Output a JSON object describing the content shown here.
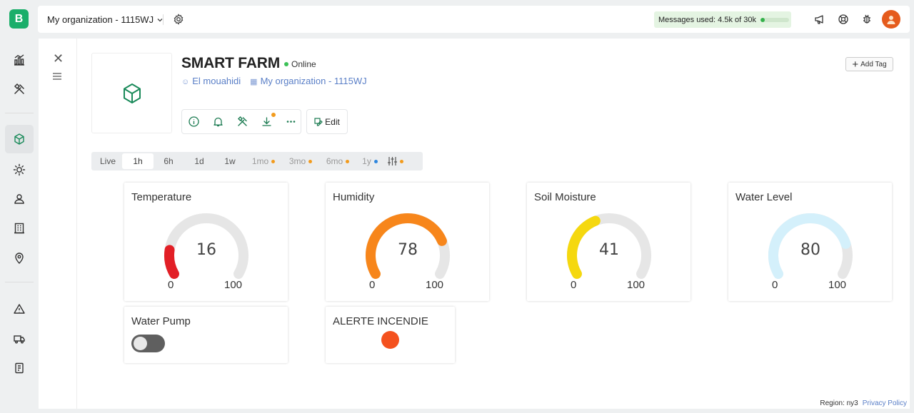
{
  "app": {
    "logo_letter": "B",
    "org_selector": "My organization - 1115WJ",
    "messages_label": "Messages used: ",
    "messages_value": "4.5k of 30k",
    "messages_fraction": 0.15
  },
  "device": {
    "name": "SMART FARM",
    "status": "Online",
    "owner": "El mouahidi",
    "organization": "My organization - 1115WJ",
    "edit_label": "Edit",
    "add_tag_label": "Add Tag"
  },
  "time_ranges": [
    {
      "label": "Live",
      "state": "normal"
    },
    {
      "label": "1h",
      "state": "selected"
    },
    {
      "label": "6h",
      "state": "normal"
    },
    {
      "label": "1d",
      "state": "normal"
    },
    {
      "label": "1w",
      "state": "normal"
    },
    {
      "label": "1mo",
      "state": "dim",
      "dot": "#f29b1d"
    },
    {
      "label": "3mo",
      "state": "dim",
      "dot": "#f29b1d"
    },
    {
      "label": "6mo",
      "state": "dim",
      "dot": "#f29b1d"
    },
    {
      "label": "1y",
      "state": "dim",
      "dot": "#2e86de"
    }
  ],
  "widgets": {
    "temperature": {
      "title": "Temperature",
      "value": "16",
      "min": "0",
      "max": "100",
      "fraction": 0.16,
      "color": "#e21f26"
    },
    "humidity": {
      "title": "Humidity",
      "value": "78",
      "min": "0",
      "max": "100",
      "fraction": 0.78,
      "color": "#f7861b"
    },
    "soil": {
      "title": "Soil Moisture",
      "value": "41",
      "min": "0",
      "max": "100",
      "fraction": 0.41,
      "color": "#f5d80f"
    },
    "water_level": {
      "title": "Water Level",
      "value": "80",
      "min": "0",
      "max": "100",
      "fraction": 0.8,
      "color": "#d4f0fb"
    },
    "pump": {
      "title": "Water Pump",
      "on": false
    },
    "fire": {
      "title": "ALERTE INCENDIE",
      "color": "#f4511e"
    }
  },
  "footer": {
    "region": "Region: ny3",
    "privacy": "Privacy Policy"
  }
}
